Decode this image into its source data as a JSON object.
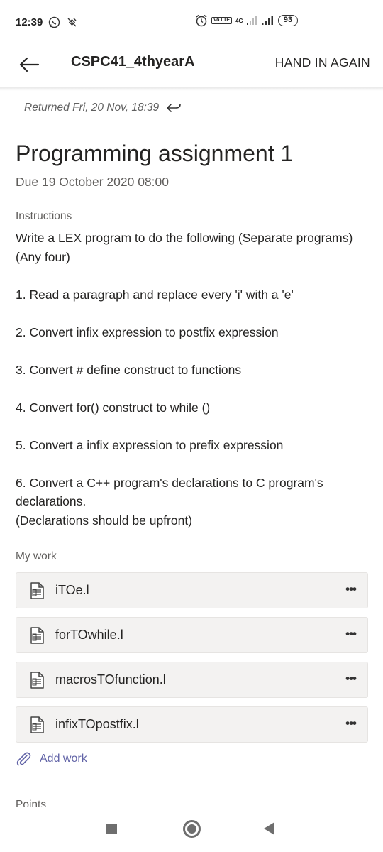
{
  "status_bar": {
    "time": "12:39",
    "battery": "93",
    "volte": "Vo LTE",
    "network": "4G"
  },
  "app_bar": {
    "title": "CSPC41_4thyearA",
    "action": "HAND IN AGAIN"
  },
  "returned": "Returned Fri, 20 Nov, 18:39",
  "assignment": {
    "title": "Programming assignment 1",
    "due": "Due 19 October 2020 08:00",
    "instructions_label": "Instructions",
    "instructions": "Write a LEX program to do the following (Separate programs) (Any four)\n\n1. Read a paragraph and replace every 'i' with a 'e'\n\n2. Convert infix expression to postfix expression\n\n3. Convert # define construct to functions\n\n4. Convert for() construct to while ()\n\n5. Convert a infix expression to prefix expression\n\n6. Convert a C++ program's declarations to C program's declarations.\n(Declarations should be upfront)"
  },
  "my_work": {
    "label": "My work",
    "files": [
      {
        "name": "iTOe.l"
      },
      {
        "name": "forTOwhile.l"
      },
      {
        "name": "macrosTOfunction.l"
      },
      {
        "name": "infixTOpostfix.l"
      }
    ],
    "more_label": "•••",
    "add_work": "Add work"
  },
  "points_label": "Points",
  "icons": {
    "back": "arrow-left-icon",
    "returned": "return-arrow-icon",
    "file": "file-icon",
    "attach": "paperclip-icon"
  },
  "colors": {
    "accent": "#6264a7",
    "text": "#252423",
    "secondary": "#605e5c",
    "file_bg": "#f3f2f1"
  }
}
